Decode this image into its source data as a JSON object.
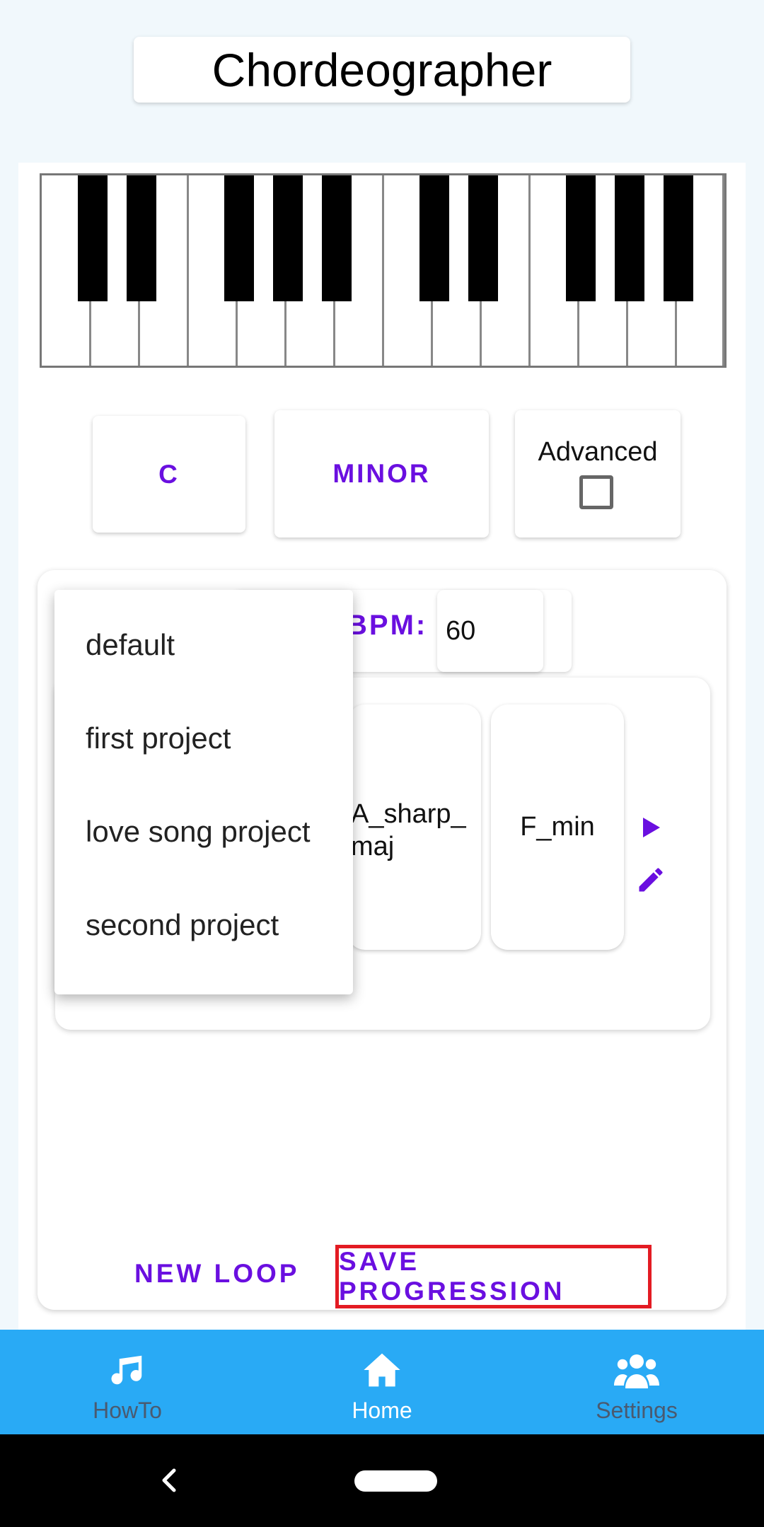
{
  "app": {
    "title": "Chordeographer"
  },
  "controls": {
    "key_label": "C",
    "mode_label": "MINOR",
    "advanced_label": "Advanced",
    "advanced_checked": false
  },
  "progression": {
    "bpm_label": "BPM:",
    "bpm_value": "60",
    "chords": [
      "A_sharp_\nmaj",
      "F_min"
    ],
    "new_loop_label": "NEW LOOP",
    "save_label": "SAVE PROGRESSION"
  },
  "dropdown": {
    "options": [
      "default",
      "first project",
      "love song project",
      "second project"
    ]
  },
  "nav": {
    "items": [
      {
        "label": "HowTo",
        "icon": "music-note-icon"
      },
      {
        "label": "Home",
        "icon": "home-icon"
      },
      {
        "label": "Settings",
        "icon": "users-icon"
      }
    ],
    "active": "Home"
  },
  "colors": {
    "accent": "#6a0fe0",
    "nav_background": "#29aaf5",
    "highlight_border": "#e31b23",
    "page_background": "#f1f8fc"
  }
}
